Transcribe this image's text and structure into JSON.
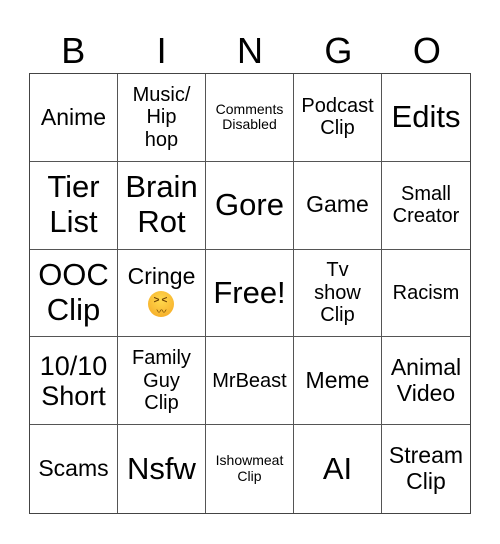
{
  "header": [
    "B",
    "I",
    "N",
    "G",
    "O"
  ],
  "cells": [
    {
      "text": "Anime",
      "size": "s22"
    },
    {
      "text": "Music/\nHip\nhop",
      "size": "s19"
    },
    {
      "text": "Comments\nDisabled",
      "size": "s13"
    },
    {
      "text": "Podcast\nClip",
      "size": "s19"
    },
    {
      "text": "Edits",
      "size": "s30"
    },
    {
      "text": "Tier\nList",
      "size": "s30"
    },
    {
      "text": "Brain\nRot",
      "size": "s30"
    },
    {
      "text": "Gore",
      "size": "s30"
    },
    {
      "text": "Game",
      "size": "s22"
    },
    {
      "text": "Small\nCreator",
      "size": "s19"
    },
    {
      "text": "OOC\nClip",
      "size": "s30"
    },
    {
      "text": "Cringe",
      "size": "s22",
      "emoji": "confounded-face"
    },
    {
      "text": "Free!",
      "size": "s30"
    },
    {
      "text": "Tv\nshow\nClip",
      "size": "s19"
    },
    {
      "text": "Racism",
      "size": "s19"
    },
    {
      "text": "10/10\nShort",
      "size": "s26"
    },
    {
      "text": "Family\nGuy\nClip",
      "size": "s19"
    },
    {
      "text": "MrBeast",
      "size": "s19"
    },
    {
      "text": "Meme",
      "size": "s22"
    },
    {
      "text": "Animal\nVideo",
      "size": "s22"
    },
    {
      "text": "Scams",
      "size": "s22"
    },
    {
      "text": "Nsfw",
      "size": "s30"
    },
    {
      "text": "Ishowmeat\nClip",
      "size": "s13"
    },
    {
      "text": "AI",
      "size": "s30"
    },
    {
      "text": "Stream\nClip",
      "size": "s22"
    }
  ]
}
